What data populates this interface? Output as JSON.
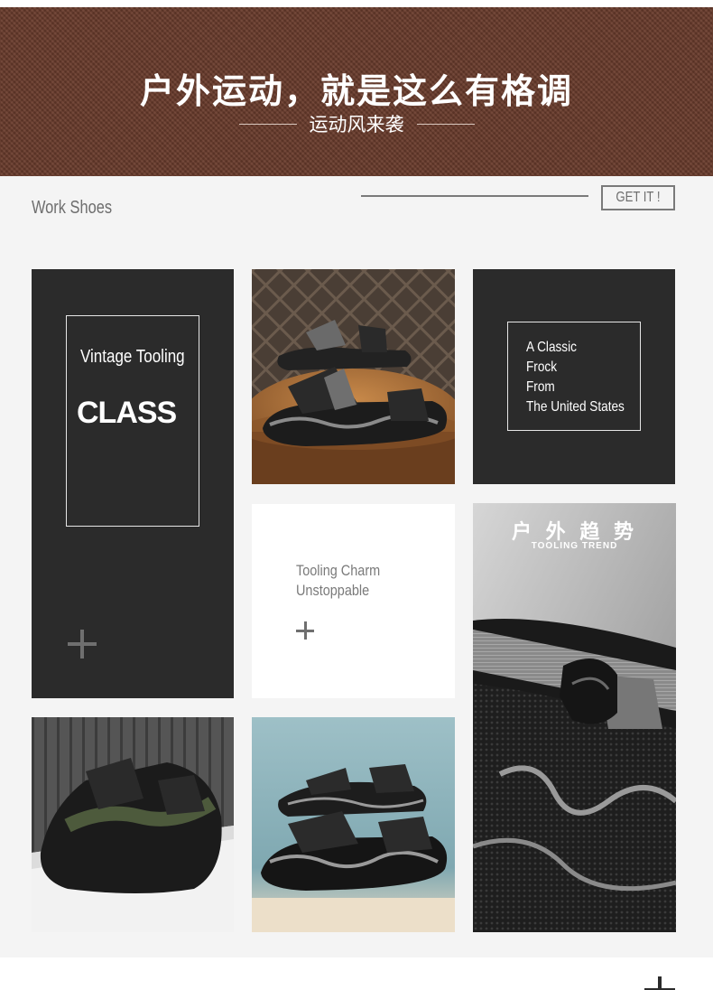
{
  "banner": {
    "title": "户外运动，就是这么有格调",
    "subtitle": "运动风来袭"
  },
  "header": {
    "section_title": "Work Shoes",
    "cta_label": "GET IT !"
  },
  "tiles": {
    "vintage": {
      "line1": "Vintage Tooling",
      "line2": "CLASS"
    },
    "classic": {
      "line1": "A Classic",
      "line2": "Frock",
      "line3": "From",
      "line4": "The United States"
    },
    "charm": {
      "line1": "Tooling Charm",
      "line2": "Unstoppable"
    },
    "trend": {
      "title": "户 外 趋 势",
      "subtitle": "TOOLING TREND"
    }
  },
  "images": {
    "photo_1": "sandals-on-wooden-stool",
    "photo_2": "closeup-sandal-strap",
    "photo_3": "green-sandal-on-white-block",
    "photo_4": "black-sandals-on-blue-background"
  },
  "colors": {
    "banner_brown": "#6a3c2c",
    "tile_dark": "#2b2b2b",
    "section_gray": "#f4f4f4"
  }
}
